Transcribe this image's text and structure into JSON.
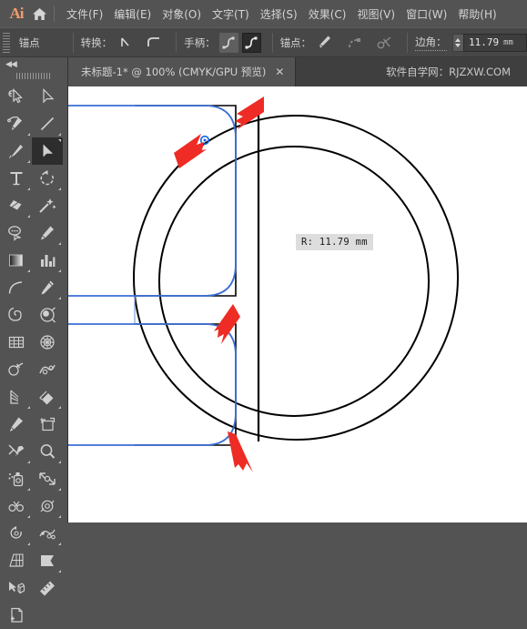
{
  "app": {
    "logo": "Ai",
    "home_icon": "home-icon"
  },
  "menubar": {
    "items": [
      {
        "label": "文件(F)",
        "name": "menu-file"
      },
      {
        "label": "编辑(E)",
        "name": "menu-edit"
      },
      {
        "label": "对象(O)",
        "name": "menu-object"
      },
      {
        "label": "文字(T)",
        "name": "menu-type"
      },
      {
        "label": "选择(S)",
        "name": "menu-select"
      },
      {
        "label": "效果(C)",
        "name": "menu-effect"
      },
      {
        "label": "视图(V)",
        "name": "menu-view"
      },
      {
        "label": "窗口(W)",
        "name": "menu-window"
      },
      {
        "label": "帮助(H)",
        "name": "menu-help"
      }
    ]
  },
  "optionsbar": {
    "context_label": "锚点",
    "convert_label": "转换：",
    "convert_icons": [
      "convert-to-corner-icon",
      "convert-to-smooth-icon"
    ],
    "handles_label": "手柄：",
    "handle_icons": [
      "show-handles-icon",
      "hide-handles-icon"
    ],
    "handle_selected_index": 1,
    "anchor_label": "锚点：",
    "anchor_icons": [
      "pen-anchor-icon",
      "remove-anchor-icon",
      "connect-anchor-icon"
    ],
    "corner_label": "边角：",
    "corner_value": "11.79",
    "corner_unit": "mm"
  },
  "tabbar": {
    "document_title": "未标题-1* @ 100% (CMYK/GPU 预览)",
    "close_glyph": "✕",
    "watermark": "软件自学网：RJZXW.COM"
  },
  "toolpanel": {
    "collapse_glyph": "◀◀",
    "tools": [
      {
        "name": "selection-tool",
        "icon": "selection-arrow-with-lasso-icon",
        "selected": false,
        "corner": false
      },
      {
        "name": "direct-selection-tool-alt",
        "icon": "direct-selection-arrow-outline-icon",
        "selected": false,
        "corner": false
      },
      {
        "name": "pen-tool",
        "icon": "pen-icon",
        "selected": false,
        "corner": true
      },
      {
        "name": "line-segment-tool",
        "icon": "line-segment-icon",
        "selected": false,
        "corner": true
      },
      {
        "name": "paintbrush-tool",
        "icon": "paintbrush-icon",
        "selected": false,
        "corner": true
      },
      {
        "name": "direct-selection-tool",
        "icon": "direct-selection-arrow-icon",
        "selected": true,
        "corner": true
      },
      {
        "name": "type-tool",
        "icon": "type-t-icon",
        "selected": false,
        "corner": true
      },
      {
        "name": "rotate-tool",
        "icon": "rotate-icon",
        "selected": false,
        "corner": true
      },
      {
        "name": "eraser-tool",
        "icon": "eraser-icon",
        "selected": false,
        "corner": true
      },
      {
        "name": "magic-wand-tool",
        "icon": "magic-wand-icon",
        "selected": false,
        "corner": false
      },
      {
        "name": "lasso-tool",
        "icon": "lasso-icon",
        "selected": false,
        "corner": false
      },
      {
        "name": "pencil-tool",
        "icon": "pencil-shaper-icon",
        "selected": false,
        "corner": true
      },
      {
        "name": "gradient-tool",
        "icon": "gradient-icon",
        "selected": false,
        "corner": true
      },
      {
        "name": "column-graph-tool",
        "icon": "bar-graph-icon",
        "selected": false,
        "corner": true
      },
      {
        "name": "arc-tool",
        "icon": "arc-icon",
        "selected": false,
        "corner": false
      },
      {
        "name": "eyedropper-tool",
        "icon": "eyedropper-icon",
        "selected": false,
        "corner": true
      },
      {
        "name": "spiral-tool",
        "icon": "spiral-icon",
        "selected": false,
        "corner": false
      },
      {
        "name": "blob-brush-tool",
        "icon": "blob-orbit-icon",
        "selected": false,
        "corner": false
      },
      {
        "name": "rectangular-grid-tool",
        "icon": "grid-icon",
        "selected": false,
        "corner": false
      },
      {
        "name": "polar-grid-tool",
        "icon": "polar-grid-icon",
        "selected": false,
        "corner": false
      },
      {
        "name": "shape-builder-tool",
        "icon": "shape-builder-icon",
        "selected": false,
        "corner": false
      },
      {
        "name": "width-tool",
        "icon": "width-swirl-icon",
        "selected": false,
        "corner": false
      },
      {
        "name": "blend-tool",
        "icon": "blend-icon",
        "selected": false,
        "corner": true
      },
      {
        "name": "live-paint-bucket-tool",
        "icon": "live-paint-icon",
        "selected": false,
        "corner": true
      },
      {
        "name": "knife-tool",
        "icon": "knife-pencil-icon",
        "selected": false,
        "corner": false
      },
      {
        "name": "artboard-tool",
        "icon": "artboard-icon",
        "selected": false,
        "corner": false
      },
      {
        "name": "scissors-tool",
        "icon": "scissors-brush-icon",
        "selected": false,
        "corner": true
      },
      {
        "name": "zoom-tool",
        "icon": "magnifier-icon",
        "selected": false,
        "corner": true
      },
      {
        "name": "symbol-sprayer-tool",
        "icon": "symbol-sprayer-icon",
        "selected": false,
        "corner": true
      },
      {
        "name": "scale-tool",
        "icon": "scale-arrows-icon",
        "selected": false,
        "corner": true
      },
      {
        "name": "warp-tool",
        "icon": "warp-gears-icon",
        "selected": false,
        "corner": true
      },
      {
        "name": "free-transform-tool",
        "icon": "free-transform-icon",
        "selected": false,
        "corner": true
      },
      {
        "name": "rotate-view-tool",
        "icon": "rotate-view-icon",
        "selected": false,
        "corner": true
      },
      {
        "name": "puppet-warp-tool",
        "icon": "puppet-warp-icon",
        "selected": false,
        "corner": true
      },
      {
        "name": "perspective-grid-tool",
        "icon": "perspective-grid-icon",
        "selected": false,
        "corner": false
      },
      {
        "name": "slice-tool",
        "icon": "slice-flag-icon",
        "selected": false,
        "corner": true
      },
      {
        "name": "perspective-selection-tool",
        "icon": "perspective-selection-icon",
        "selected": false,
        "corner": false
      },
      {
        "name": "measure-tool",
        "icon": "ruler-icon",
        "selected": false,
        "corner": false
      },
      {
        "name": "new-artboard-tool",
        "icon": "new-document-icon",
        "selected": false,
        "corner": false
      }
    ]
  },
  "canvas": {
    "measure_tooltip": "R: 11.79 mm",
    "colors": {
      "artwork_stroke": "#000000",
      "selection_stroke": "#3b6fd4",
      "anchor_marker": "#1565e0",
      "annotation_arrow": "#ee2b24",
      "background": "#ffffff"
    },
    "annotation_arrows": [
      {
        "name": "arrow-top-corner",
        "points_to": "top-right-corner-of-rounded-rect"
      },
      {
        "name": "arrow-anchor-widget",
        "points_to": "live-corner-widget"
      },
      {
        "name": "arrow-middle-corner",
        "points_to": "inner-corner-radius"
      },
      {
        "name": "arrow-bottom-corner",
        "points_to": "bottom-right-corner-of-rounded-rect"
      }
    ]
  }
}
